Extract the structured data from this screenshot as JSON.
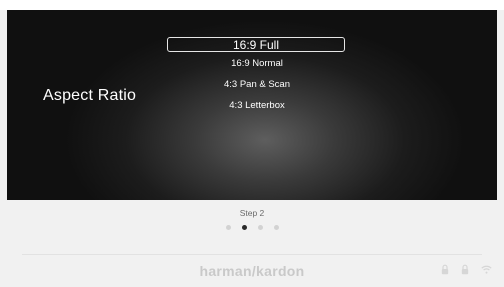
{
  "screen": {
    "title": "Aspect Ratio",
    "options": [
      "16:9 Full",
      "16:9 Normal",
      "4:3 Pan & Scan",
      "4:3 Letterbox"
    ],
    "selected_index": 0
  },
  "setup": {
    "step_label": "Step 2",
    "total_steps": 4,
    "current_step": 2
  },
  "footer": {
    "brand": "harman/kardon",
    "icons": [
      "lock-icon",
      "lock-icon",
      "wifi-icon"
    ]
  },
  "colors": {
    "background": "#f1f1f1",
    "screen_text": "#ffffff",
    "active_dot": "#2a2a2a",
    "inactive_dot": "#d2d2d2"
  }
}
